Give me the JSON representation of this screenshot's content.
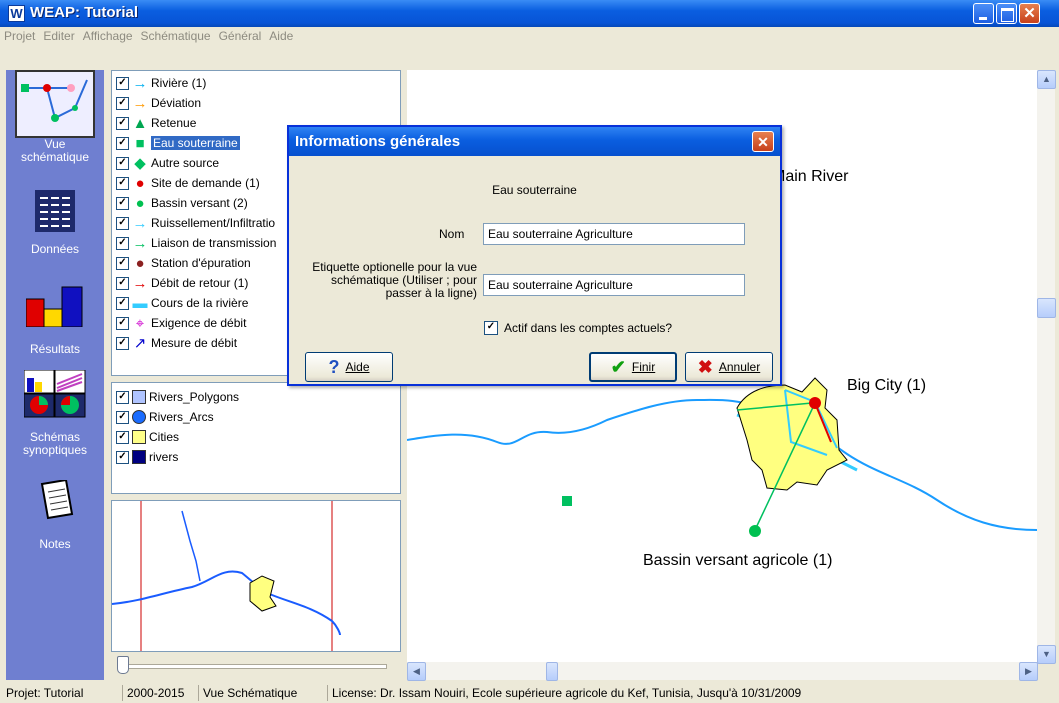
{
  "window": {
    "title": "WEAP: Tutorial",
    "app_icon": "W"
  },
  "menu": [
    "Projet",
    "Editer",
    "Affichage",
    "Schématique",
    "Général",
    "Aide"
  ],
  "viewbar": {
    "items": [
      {
        "label": "Vue\nschématique",
        "icon": "schematic-icon"
      },
      {
        "label": "Données",
        "icon": "data-icon"
      },
      {
        "label": "Résultats",
        "icon": "results-icon"
      },
      {
        "label": "Schémas\nsynoptiques",
        "icon": "overviews-icon"
      },
      {
        "label": "Notes",
        "icon": "notes-icon"
      }
    ]
  },
  "legend": {
    "items": [
      {
        "label": "Rivière (1)",
        "icon": "river-arrow-icon",
        "color": "#00b0f0"
      },
      {
        "label": "Déviation",
        "icon": "diversion-arrow-icon",
        "color": "#ff9900"
      },
      {
        "label": "Retenue",
        "icon": "reservoir-triangle-icon",
        "color": "#00a651"
      },
      {
        "label": "Eau souterraine",
        "icon": "groundwater-square-icon",
        "color": "#00c060"
      },
      {
        "label": "Autre source",
        "icon": "other-source-diamond-icon",
        "color": "#00c060"
      },
      {
        "label": "Site de demande (1)",
        "icon": "demand-site-dot-icon",
        "color": "#e00000"
      },
      {
        "label": "Bassin versant (2)",
        "icon": "catchment-dot-icon",
        "color": "#00c050"
      },
      {
        "label": "Ruissellement/Infiltratio",
        "icon": "runoff-arrow-icon",
        "color": "#33ccff"
      },
      {
        "label": "Liaison de transmission",
        "icon": "transmission-arrow-icon",
        "color": "#00c060"
      },
      {
        "label": "Station d'épuration",
        "icon": "treatment-dot-icon",
        "color": "#8b2020"
      },
      {
        "label": "Débit de retour (1)",
        "icon": "return-flow-arrow-icon",
        "color": "#e00000"
      },
      {
        "label": "Cours de la rivière",
        "icon": "river-reach-bar-icon",
        "color": "#33ccff"
      },
      {
        "label": "Exigence de débit",
        "icon": "flow-requirement-icon",
        "color": "#cc00cc"
      },
      {
        "label": "Mesure de débit",
        "icon": "streamflow-gauge-icon",
        "color": "#0000cc"
      }
    ],
    "selected_index": 3
  },
  "layers": {
    "items": [
      {
        "label": "Rivers_Polygons",
        "color": "#b0c4ff"
      },
      {
        "label": "Rivers_Arcs",
        "color": "#1a6cff"
      },
      {
        "label": "Cities",
        "color": "#ffff88"
      },
      {
        "label": "rivers",
        "color": "#000080"
      }
    ]
  },
  "map": {
    "labels": {
      "river": "Main River",
      "city": "Big City (1)",
      "catchment": "Bassin versant agricole (1)"
    }
  },
  "dialog": {
    "title": "Informations générales",
    "heading": "Eau souterraine",
    "name_label": "Nom",
    "name_value": "Eau souterraine Agriculture",
    "tag_label": "Etiquette optionelle pour la vue schématique (Utiliser ; pour passer à la ligne)",
    "tag_value": "Eau souterraine Agriculture",
    "active_label": "Actif dans les comptes actuels?",
    "active_checked": true,
    "help_button": "Aide",
    "finish_button": "Finir",
    "cancel_button": "Annuler"
  },
  "status": {
    "project": "Projet: Tutorial",
    "years": "2000-2015",
    "view": "Vue Schématique",
    "license": "License: Dr. Issam Nouiri, Ecole supérieure agricole du Kef, Tunisia, Jusqu'à 10/31/2009"
  }
}
